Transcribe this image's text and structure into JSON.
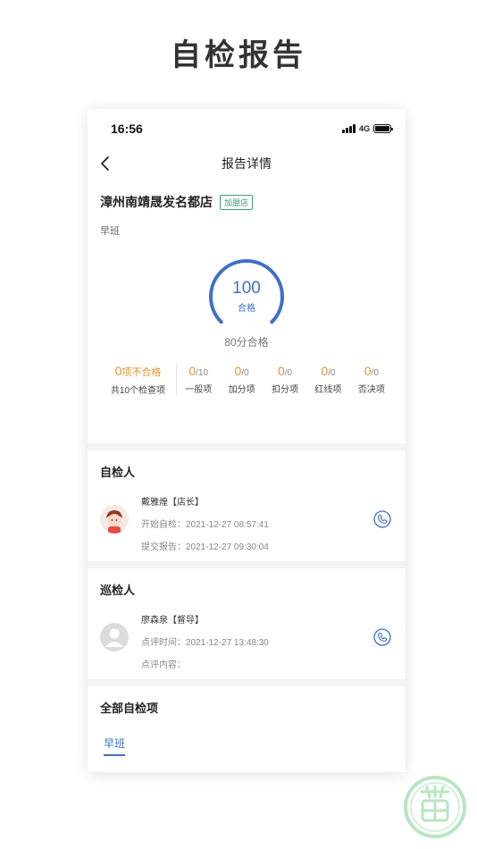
{
  "hero": {
    "title": "自检报告"
  },
  "status_bar": {
    "time": "16:56",
    "network": "4G"
  },
  "nav": {
    "title": "报告详情"
  },
  "store": {
    "name": "漳州南靖晟发名都店",
    "badge": "加盟店",
    "shift": "早班",
    "score": "100",
    "score_label": "合格",
    "pass_line": "80分合格",
    "stats": {
      "unqualified": {
        "value": "0",
        "suffix": "项不合格",
        "label": "共10个检查项"
      },
      "items": [
        {
          "value": "0",
          "denom": "/10",
          "label": "一般项"
        },
        {
          "value": "0",
          "denom": "/0",
          "label": "加分项"
        },
        {
          "value": "0",
          "denom": "/0",
          "label": "扣分项"
        },
        {
          "value": "0",
          "denom": "/0",
          "label": "红线项"
        },
        {
          "value": "0",
          "denom": "/0",
          "label": "否决项"
        }
      ]
    }
  },
  "self_inspector": {
    "title": "自检人",
    "name": "戴雅煌【店长】",
    "start": "开始自检：2021-12-27 08:57:41",
    "submit": "提交报告：2021-12-27 09:30:04"
  },
  "patrol_inspector": {
    "title": "巡检人",
    "name": "廖森泉【督导】",
    "review_time": "点评时间：2021-12-27 13:48:30",
    "review_content": "点评内容："
  },
  "all_items": {
    "title": "全部自检项",
    "tab": "早班",
    "group": "早班"
  },
  "colors": {
    "accent": "#3f6fc8",
    "warning": "#e0962e",
    "badge": "#3aa07a"
  }
}
